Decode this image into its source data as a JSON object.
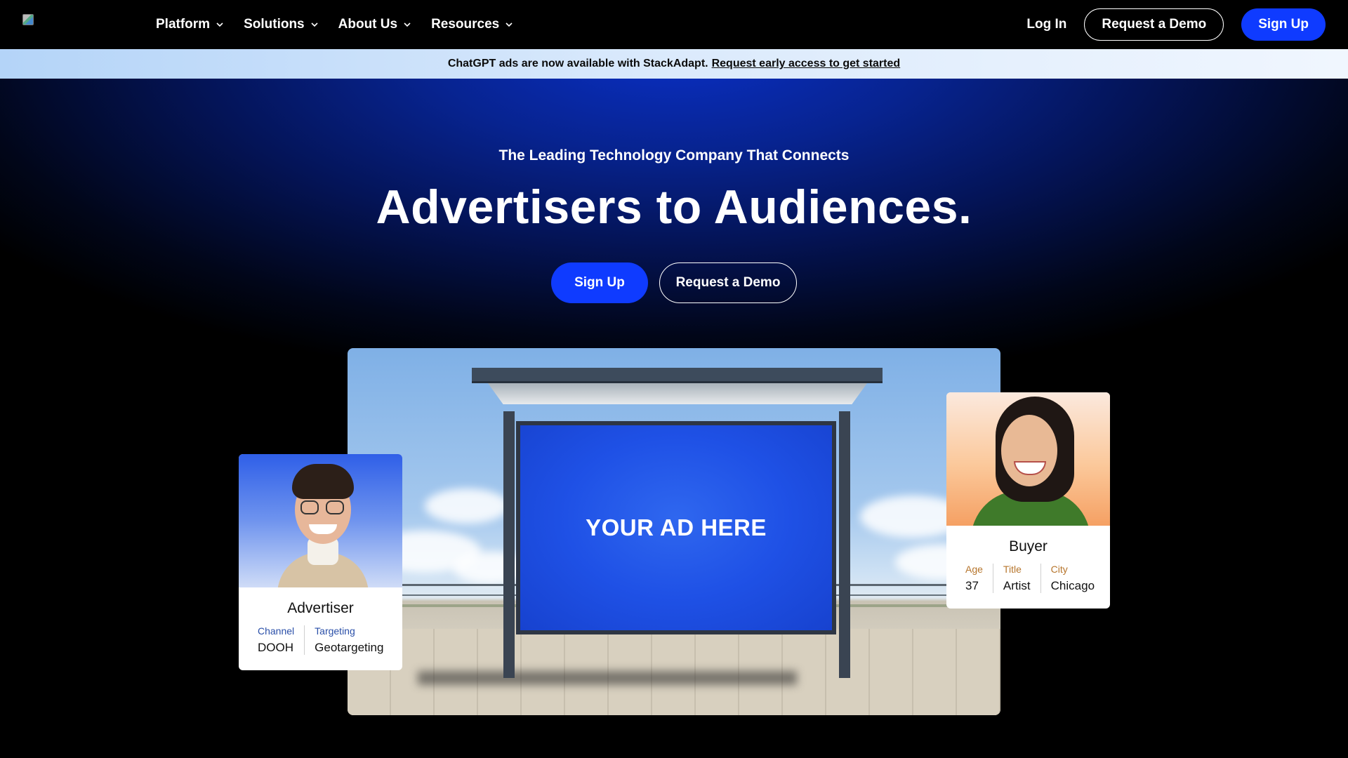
{
  "nav": {
    "menu": [
      {
        "label": "Platform"
      },
      {
        "label": "Solutions"
      },
      {
        "label": "About Us"
      },
      {
        "label": "Resources"
      }
    ],
    "login_label": "Log In",
    "demo_label": "Request a Demo",
    "signup_label": "Sign Up"
  },
  "announcement": {
    "text": "ChatGPT ads are now available with StackAdapt.",
    "link": "Request early access to get started"
  },
  "hero": {
    "kicker": "The Leading Technology Company That Connects",
    "headline": "Advertisers to Audiences.",
    "signup_label": "Sign Up",
    "demo_label": "Request a Demo",
    "ad_text": "YOUR AD HERE"
  },
  "advertiser_card": {
    "role": "Advertiser",
    "fields": [
      {
        "key": "Channel",
        "value": "DOOH"
      },
      {
        "key": "Targeting",
        "value": "Geotargeting"
      }
    ]
  },
  "buyer_card": {
    "role": "Buyer",
    "fields": [
      {
        "key": "Age",
        "value": "37"
      },
      {
        "key": "Title",
        "value": "Artist"
      },
      {
        "key": "City",
        "value": "Chicago"
      }
    ]
  },
  "colors": {
    "brand_blue": "#0f3bff",
    "advertiser_key": "#2a4fa8",
    "buyer_key": "#b6752c"
  }
}
